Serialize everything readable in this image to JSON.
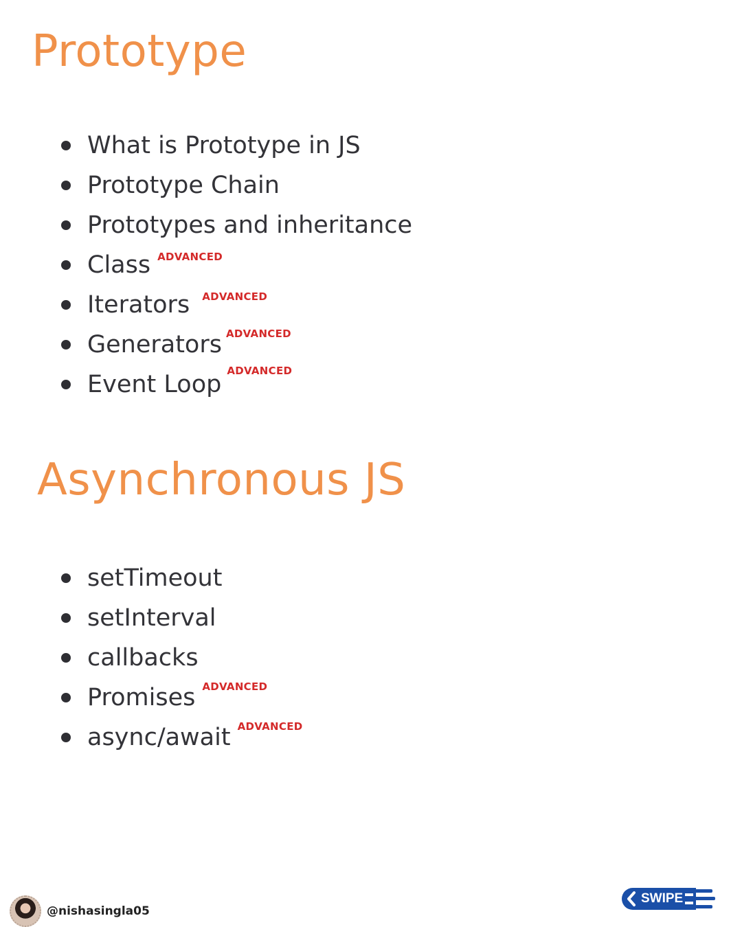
{
  "sections": [
    {
      "title": "Prototype",
      "items": [
        {
          "label": "What is Prototype in JS",
          "badge": ""
        },
        {
          "label": "Prototype Chain",
          "badge": ""
        },
        {
          "label": "Prototypes and inheritance",
          "badge": ""
        },
        {
          "label": "Class",
          "badge": "ADVANCED"
        },
        {
          "label": "Iterators",
          "badge": "ADVANCED"
        },
        {
          "label": "Generators",
          "badge": "ADVANCED"
        },
        {
          "label": "Event Loop",
          "badge": "ADVANCED"
        }
      ]
    },
    {
      "title": "Asynchronous JS",
      "items": [
        {
          "label": "setTimeout",
          "badge": ""
        },
        {
          "label": "setInterval",
          "badge": ""
        },
        {
          "label": "callbacks",
          "badge": ""
        },
        {
          "label": "Promises",
          "badge": "ADVANCED"
        },
        {
          "label": "async/await",
          "badge": "ADVANCED"
        }
      ]
    }
  ],
  "footer": {
    "handle": "@nishasingla05",
    "swipe_label": "SWIPE",
    "swipe_icon": "chevron-left-icon"
  },
  "colors": {
    "title": "#f0914a",
    "badge": "#d42a2a",
    "swipe": "#1a4fa8"
  }
}
